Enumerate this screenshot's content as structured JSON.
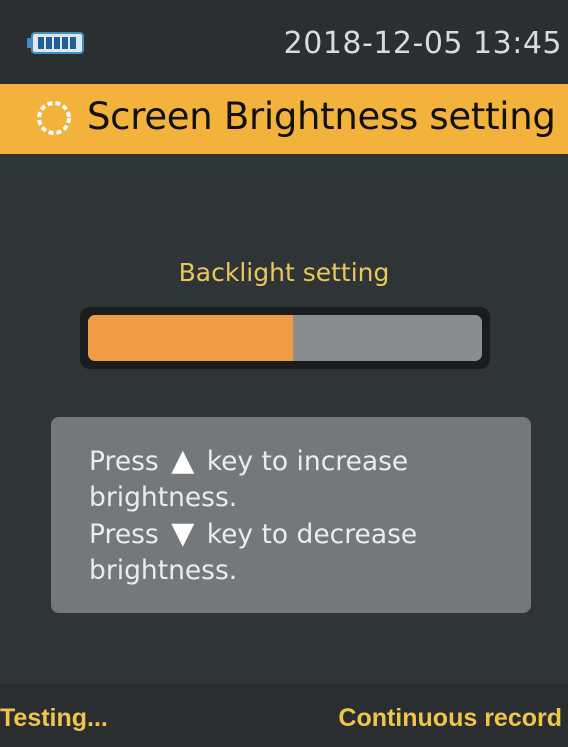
{
  "status_bar": {
    "battery_icon": "battery-full-icon",
    "datetime": "2018-12-05 13:45"
  },
  "title_bar": {
    "icon": "gear-icon",
    "title": "Screen Brightness setting"
  },
  "backlight": {
    "label": "Backlight setting",
    "level_fraction": 0.52
  },
  "help": {
    "line1_prefix": "Press",
    "line1_suffix": "key to increase",
    "line2": "brightness.",
    "line3_prefix": "Press",
    "line3_suffix": "key to decrease",
    "line4": "brightness.",
    "up_icon": "up-arrow-icon",
    "down_icon": "down-arrow-icon"
  },
  "bottom_bar": {
    "left": "Testing...",
    "right": "Continuous record"
  },
  "colors": {
    "accent": "#f3b23c",
    "slider_fill": "#ef9c44",
    "label_yellow": "#e8c85a",
    "background": "#2f3436"
  }
}
